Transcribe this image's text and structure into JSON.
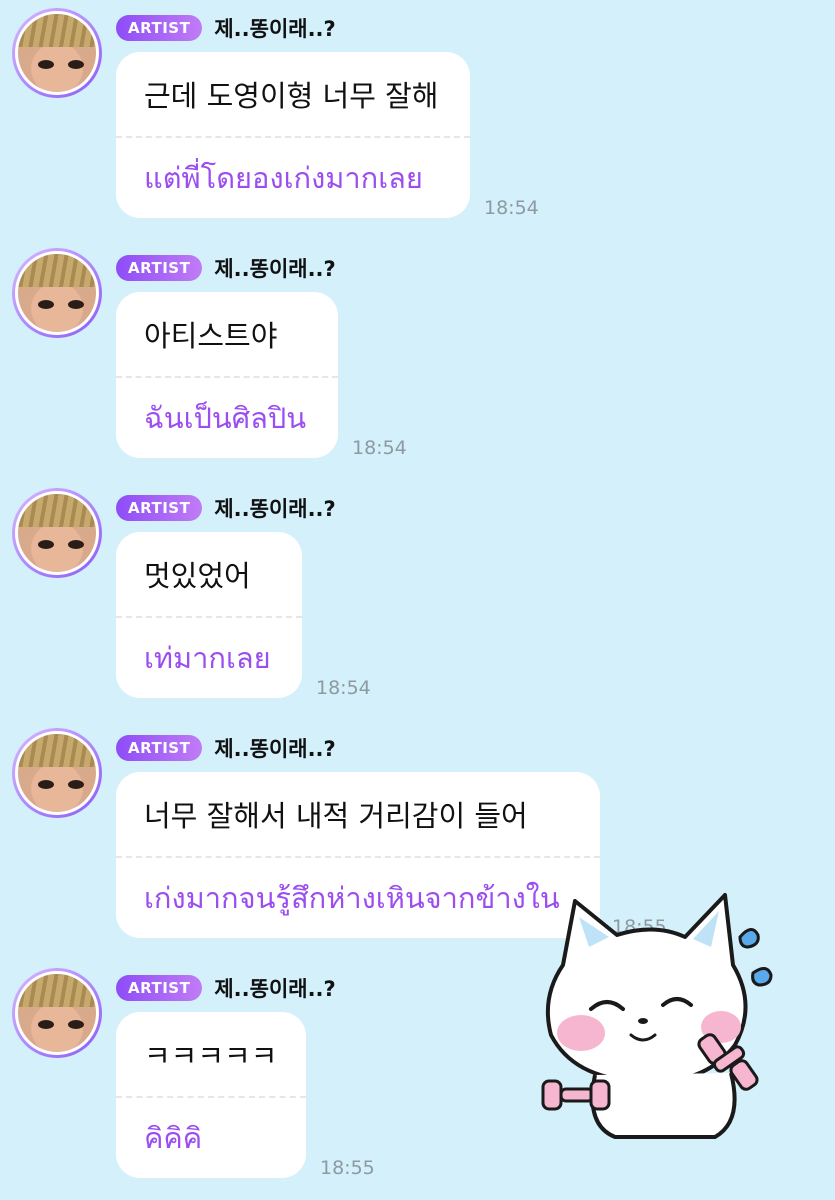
{
  "messages": [
    {
      "badge": "ARTIST",
      "name": "제..똥이래..?",
      "original": "근데 도영이형 너무 잘해",
      "translation": "แต่พี่โดยองเก่งมากเลย",
      "time": "18:54"
    },
    {
      "badge": "ARTIST",
      "name": "제..똥이래..?",
      "original": "아티스트야",
      "translation": "ฉันเป็นศิลปิน",
      "time": "18:54"
    },
    {
      "badge": "ARTIST",
      "name": "제..똥이래..?",
      "original": "멋있었어",
      "translation": "เท่มากเลย",
      "time": "18:54"
    },
    {
      "badge": "ARTIST",
      "name": "제..똥이래..?",
      "original": "너무 잘해서 내적 거리감이 들어",
      "translation": "เก่งมากจนรู้สึกห่างเหินจากข้างใน",
      "time": "18:55"
    },
    {
      "badge": "ARTIST",
      "name": "제..똥이래..?",
      "original": "ㅋㅋㅋㅋㅋ",
      "translation": "คิคิคิ",
      "time": "18:55"
    }
  ],
  "colors": {
    "background": "#d3f0fb",
    "badge": "#8e4df6",
    "translation_text": "#9b4df0"
  },
  "sticker": {
    "icon": "cat-sticker-icon"
  }
}
